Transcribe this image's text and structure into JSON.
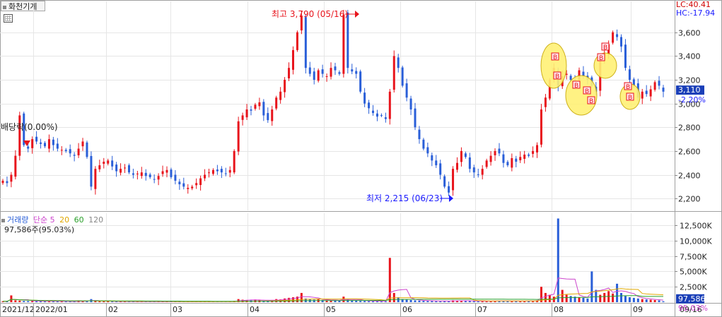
{
  "window": {
    "tab_title": "화천기계"
  },
  "price_panel": {
    "lc_label": "LC:40.41",
    "hc_label": "HC:-17.94",
    "current_price": "3,110",
    "current_change": "-2.20%",
    "dividend_label": "배당락(0.00%)",
    "high_label": "최고 3,790 (05/16)",
    "low_label": "최저 2,215 (06/23)",
    "y_ticks": [
      "3,600",
      "3,400",
      "3,200",
      "3,000",
      "2,800",
      "2,600",
      "2,400",
      "2,200"
    ],
    "y_range": [
      2100,
      3860
    ]
  },
  "volume_panel": {
    "legend": {
      "vol": "거래량",
      "ma5": "단순 5",
      "ma20": "20",
      "ma60": "60",
      "ma120": "120"
    },
    "readout": "97,586주(95.03%)",
    "current_volume": "97,586",
    "current_pct": "95.03%",
    "y_ticks": [
      "12,500K",
      "10,000K",
      "7,500K",
      "5,000K",
      "2,500K"
    ]
  },
  "x_axis": {
    "labels": [
      "2021/12",
      "2022/01",
      "02",
      "03",
      "04",
      "05",
      "06",
      "07",
      "08",
      "09",
      "09/16"
    ]
  },
  "colors": {
    "up": "#e8141c",
    "down": "#2a5fd8",
    "ma5": "#cc44cc",
    "ma20": "#e0a800",
    "ma60": "#2aa02a",
    "ma120": "#888888",
    "marker_fill": "#fff176"
  },
  "chart_data": {
    "type": "candlestick",
    "title": "화천기계",
    "x": [
      "2021/12",
      "2022/01",
      "02",
      "03",
      "04",
      "05",
      "06",
      "07",
      "08",
      "09"
    ],
    "annotations": [
      {
        "text": "최고 3,790 (05/16)",
        "value": 3790,
        "date": "05/16"
      },
      {
        "text": "최저 2,215 (06/23)",
        "value": 2215,
        "date": "06/23"
      },
      {
        "text": "배당락(0.00%)",
        "value": null
      }
    ],
    "last_close": 3110,
    "last_change_pct": -2.2,
    "price_series": [
      2350,
      2330,
      2400,
      2560,
      2900,
      2650,
      2620,
      2700,
      2680,
      2660,
      2640,
      2700,
      2650,
      2620,
      2610,
      2600,
      2580,
      2560,
      2620,
      2680,
      2550,
      2300,
      2450,
      2480,
      2510,
      2520,
      2470,
      2430,
      2450,
      2460,
      2420,
      2400,
      2410,
      2420,
      2390,
      2380,
      2360,
      2390,
      2430,
      2440,
      2380,
      2350,
      2320,
      2300,
      2290,
      2300,
      2330,
      2370,
      2400,
      2420,
      2440,
      2430,
      2420,
      2410,
      2440,
      2600,
      2850,
      2900,
      2950,
      2940,
      2990,
      3010,
      2900,
      2860,
      2950,
      3050,
      3100,
      3200,
      3300,
      3450,
      3600,
      3740,
      3300,
      3250,
      3200,
      3280,
      3250,
      3230,
      3300,
      3280,
      3250,
      3750,
      3300,
      3270,
      3250,
      3100,
      3000,
      2960,
      2920,
      2890,
      2900,
      2870,
      3100,
      3400,
      3300,
      3150,
      3050,
      2950,
      2800,
      2700,
      2620,
      2580,
      2520,
      2480,
      2400,
      2300,
      2250,
      2450,
      2500,
      2600,
      2550,
      2450,
      2420,
      2400,
      2450,
      2520,
      2560,
      2600,
      2580,
      2500,
      2480,
      2540,
      2510,
      2550,
      2570,
      2560,
      2600,
      2650,
      2950,
      3050,
      3200,
      3300,
      3150,
      3230,
      3250,
      3200,
      3180,
      3280,
      3230,
      3200,
      3150,
      3100,
      3380,
      3420,
      3500,
      3600,
      3560,
      3480,
      3300,
      3200,
      3150,
      3050,
      3100,
      3080,
      3120,
      3180,
      3150,
      3100
    ],
    "volume_series_k": [
      150,
      130,
      1100,
      300,
      250,
      200,
      180,
      170,
      160,
      150,
      140,
      200,
      150,
      140,
      130,
      120,
      110,
      100,
      300,
      200,
      150,
      500,
      200,
      150,
      140,
      130,
      120,
      110,
      100,
      100,
      100,
      90,
      90,
      90,
      80,
      80,
      80,
      80,
      90,
      90,
      80,
      80,
      80,
      70,
      70,
      70,
      80,
      90,
      100,
      110,
      100,
      90,
      80,
      80,
      90,
      200,
      500,
      400,
      350,
      300,
      400,
      350,
      250,
      250,
      300,
      500,
      450,
      600,
      700,
      800,
      900,
      1500,
      600,
      500,
      400,
      450,
      350,
      300,
      300,
      300,
      250,
      900,
      400,
      300,
      250,
      200,
      200,
      150,
      150,
      150,
      150,
      150,
      7200,
      1500,
      800,
      500,
      400,
      350,
      300,
      250,
      220,
      200,
      180,
      160,
      150,
      200,
      180,
      300,
      250,
      220,
      200,
      180,
      160,
      150,
      160,
      180,
      200,
      220,
      200,
      180,
      160,
      180,
      170,
      180,
      190,
      200,
      220,
      300,
      2500,
      1500,
      1200,
      900,
      13600,
      2000,
      1200,
      1000,
      900,
      800,
      700,
      600,
      5000,
      2000,
      1200,
      1500,
      1800,
      1400,
      3000,
      1500,
      1000,
      800,
      700,
      600,
      500,
      450,
      400,
      350,
      300,
      150
    ],
    "ylim": [
      2100,
      3860
    ]
  }
}
